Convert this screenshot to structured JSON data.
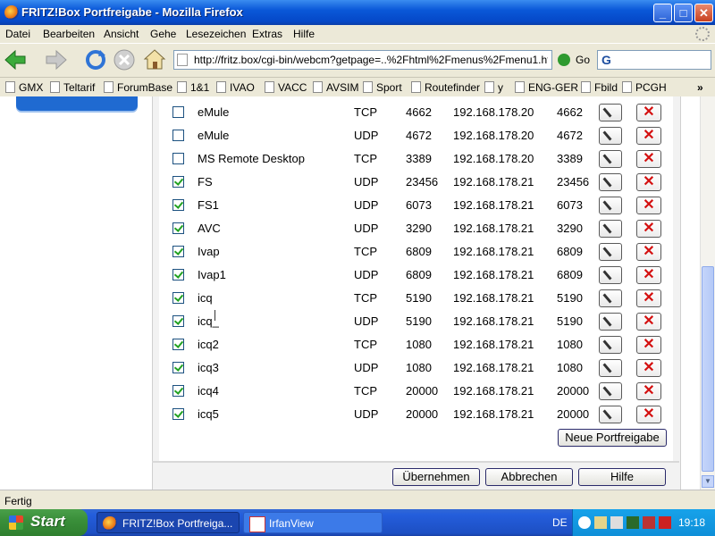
{
  "window": {
    "title": "FRITZ!Box Portfreigabe - Mozilla Firefox",
    "minimize": "_",
    "maximize": "□",
    "close": "✕"
  },
  "menu": [
    "Datei",
    "Bearbeiten",
    "Ansicht",
    "Gehe",
    "Lesezeichen",
    "Extras",
    "Hilfe"
  ],
  "nav": {
    "url": "http://fritz.box/cgi-bin/webcm?getpage=..%2Fhtml%2Fmenus%2Fmenu1.htı",
    "go_label": "Go",
    "search_logo": "G"
  },
  "bookmarks": [
    "GMX",
    "Teltarif",
    "ForumBase",
    "1&1",
    "IVAO",
    "VACC",
    "AVSIM",
    "Sport",
    "Routefinder",
    "y",
    "ENG-GER",
    "Fbild",
    "PCGH"
  ],
  "bookmarks_more": "»",
  "rules": [
    {
      "checked": false,
      "name": "eMule",
      "proto": "TCP",
      "port": "4662",
      "ip": "192.168.178.20",
      "to_port": "4662"
    },
    {
      "checked": false,
      "name": "eMule",
      "proto": "UDP",
      "port": "4672",
      "ip": "192.168.178.20",
      "to_port": "4672"
    },
    {
      "checked": false,
      "name": "MS Remote Desktop",
      "proto": "TCP",
      "port": "3389",
      "ip": "192.168.178.20",
      "to_port": "3389"
    },
    {
      "checked": true,
      "name": "FS",
      "proto": "UDP",
      "port": "23456",
      "ip": "192.168.178.21",
      "to_port": "23456"
    },
    {
      "checked": true,
      "name": "FS1",
      "proto": "UDP",
      "port": "6073",
      "ip": "192.168.178.21",
      "to_port": "6073"
    },
    {
      "checked": true,
      "name": "AVC",
      "proto": "UDP",
      "port": "3290",
      "ip": "192.168.178.21",
      "to_port": "3290"
    },
    {
      "checked": true,
      "name": "Ivap",
      "proto": "TCP",
      "port": "6809",
      "ip": "192.168.178.21",
      "to_port": "6809"
    },
    {
      "checked": true,
      "name": "Ivap1",
      "proto": "UDP",
      "port": "6809",
      "ip": "192.168.178.21",
      "to_port": "6809"
    },
    {
      "checked": true,
      "name": "icq",
      "proto": "TCP",
      "port": "5190",
      "ip": "192.168.178.21",
      "to_port": "5190"
    },
    {
      "checked": true,
      "name": "icq_",
      "proto": "UDP",
      "port": "5190",
      "ip": "192.168.178.21",
      "to_port": "5190"
    },
    {
      "checked": true,
      "name": "icq2",
      "proto": "TCP",
      "port": "1080",
      "ip": "192.168.178.21",
      "to_port": "1080"
    },
    {
      "checked": true,
      "name": "icq3",
      "proto": "UDP",
      "port": "1080",
      "ip": "192.168.178.21",
      "to_port": "1080"
    },
    {
      "checked": true,
      "name": "icq4",
      "proto": "TCP",
      "port": "20000",
      "ip": "192.168.178.21",
      "to_port": "20000"
    },
    {
      "checked": true,
      "name": "icq5",
      "proto": "UDP",
      "port": "20000",
      "ip": "192.168.178.21",
      "to_port": "20000"
    }
  ],
  "buttons": {
    "new_rule": "Neue Portfreigabe",
    "apply": "Übernehmen",
    "cancel": "Abbrechen",
    "help": "Hilfe",
    "delete_glyph": "✕"
  },
  "status": {
    "text": "Fertig"
  },
  "taskbar": {
    "start": "Start",
    "tasks": [
      "FRITZ!Box Portfreiga...",
      "IrfanView"
    ],
    "lang": "DE",
    "clock": "19:18"
  },
  "colors": {
    "titlebar": "#0a58d8",
    "taskbar": "#245edc",
    "start": "#3a8f3a",
    "checkmark": "#21a121",
    "delete": "#d41010"
  }
}
